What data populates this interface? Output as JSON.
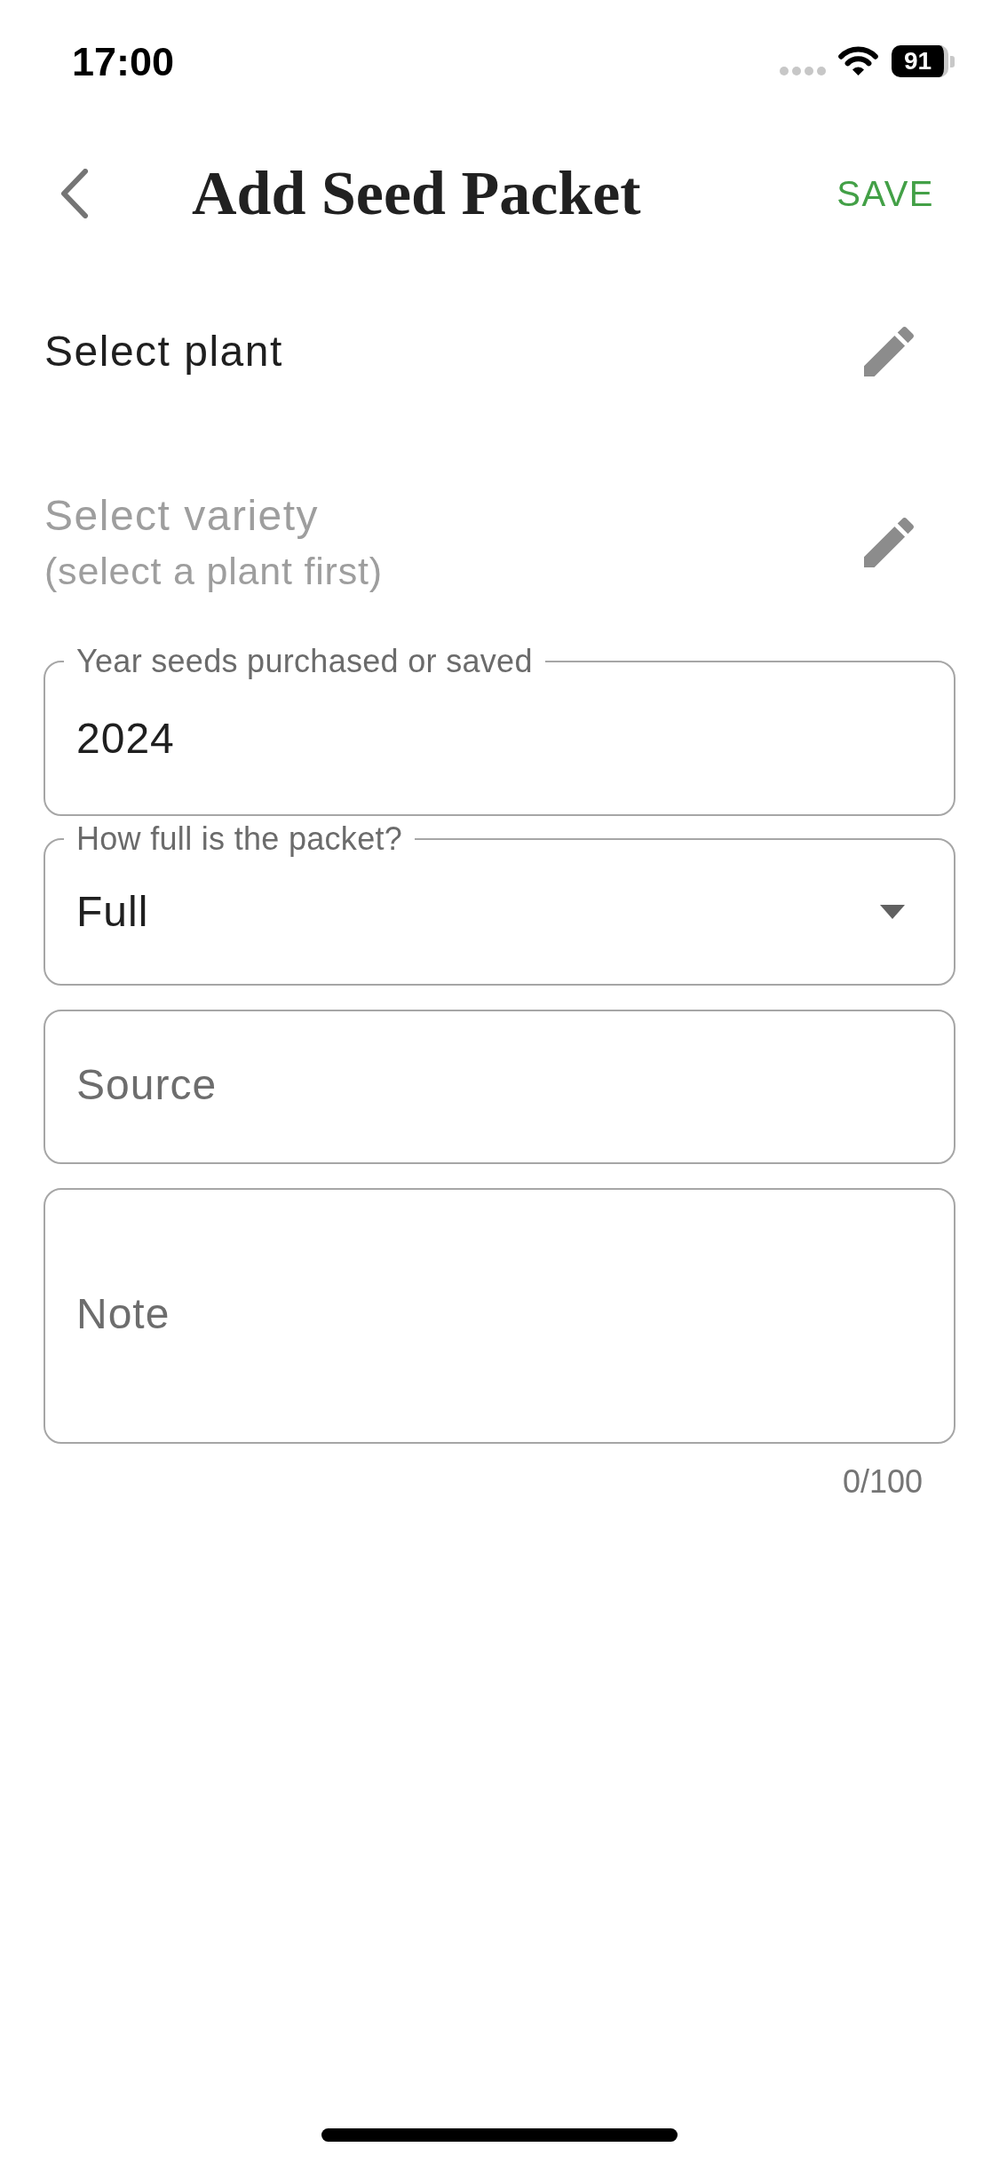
{
  "status_bar": {
    "time": "17:00",
    "battery": "91"
  },
  "app_bar": {
    "title": "Add Seed Packet",
    "action": "SAVE"
  },
  "pickers": [
    {
      "label": "Select plant",
      "disabled": false
    },
    {
      "label": "Select variety",
      "hint": "(select a plant first)",
      "disabled": true
    }
  ],
  "fields": [
    {
      "kind": "text",
      "label": "Year seeds purchased or saved",
      "value": "2024"
    },
    {
      "kind": "dropdown",
      "label": "How full is the packet?",
      "value": "Full"
    },
    {
      "kind": "text",
      "placeholder": "Source"
    },
    {
      "kind": "multiline",
      "placeholder": "Note",
      "counter": "0/100"
    }
  ]
}
